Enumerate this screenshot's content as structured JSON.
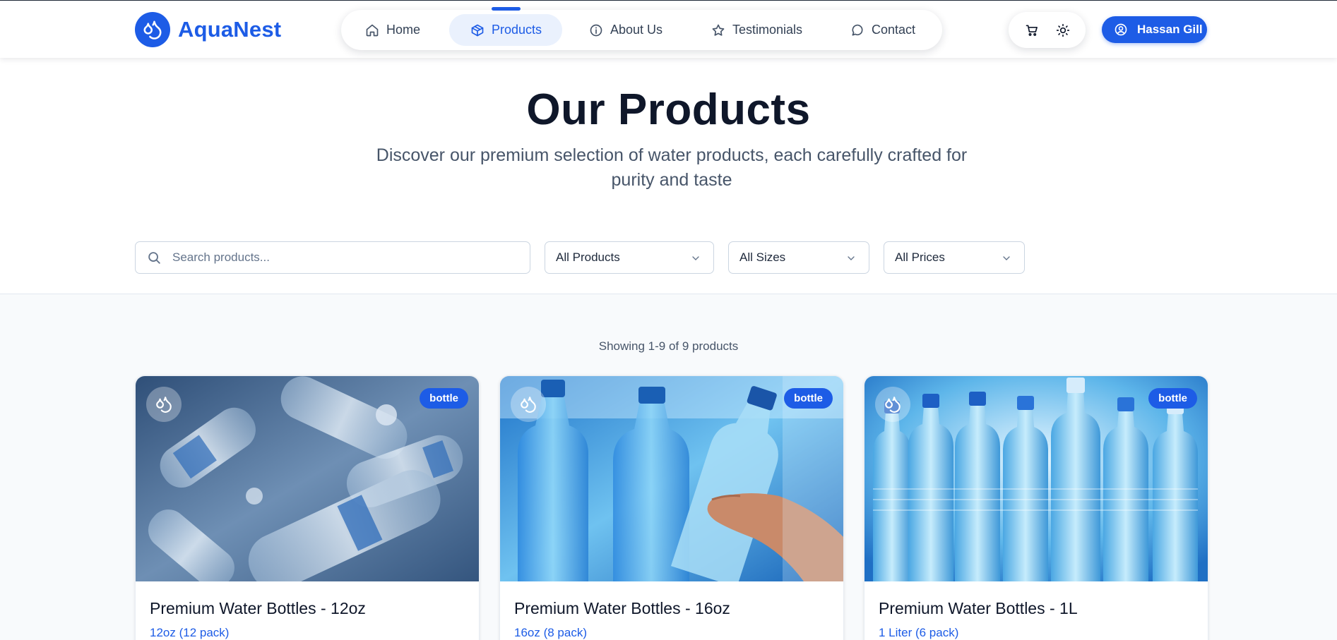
{
  "brand": {
    "name": "AquaNest",
    "accent": "#1d5ce6"
  },
  "nav": {
    "items": [
      {
        "label": "Home",
        "icon": "home-icon"
      },
      {
        "label": "Products",
        "icon": "box-icon",
        "active": true
      },
      {
        "label": "About Us",
        "icon": "info-icon"
      },
      {
        "label": "Testimonials",
        "icon": "star-icon"
      },
      {
        "label": "Contact",
        "icon": "chat-bubble-icon"
      }
    ]
  },
  "header_actions": {
    "cart_icon": "cart-icon",
    "theme_icon": "sun-icon",
    "user": {
      "name": "Hassan Gill",
      "icon": "user-circle-icon"
    }
  },
  "hero": {
    "title": "Our Products",
    "subtitle": "Discover our premium selection of water products, each carefully crafted for purity and taste"
  },
  "filters": {
    "search_placeholder": "Search products...",
    "category": "All Products",
    "size": "All Sizes",
    "price": "All Prices"
  },
  "listing": {
    "count_text": "Showing 1-9 of 9 products",
    "products": [
      {
        "name": "Premium Water Bottles - 12oz",
        "size": "12oz (12 pack)",
        "badge": "bottle"
      },
      {
        "name": "Premium Water Bottles - 16oz",
        "size": "16oz (8 pack)",
        "badge": "bottle"
      },
      {
        "name": "Premium Water Bottles - 1L",
        "size": "1 Liter (6 pack)",
        "badge": "bottle"
      }
    ]
  }
}
